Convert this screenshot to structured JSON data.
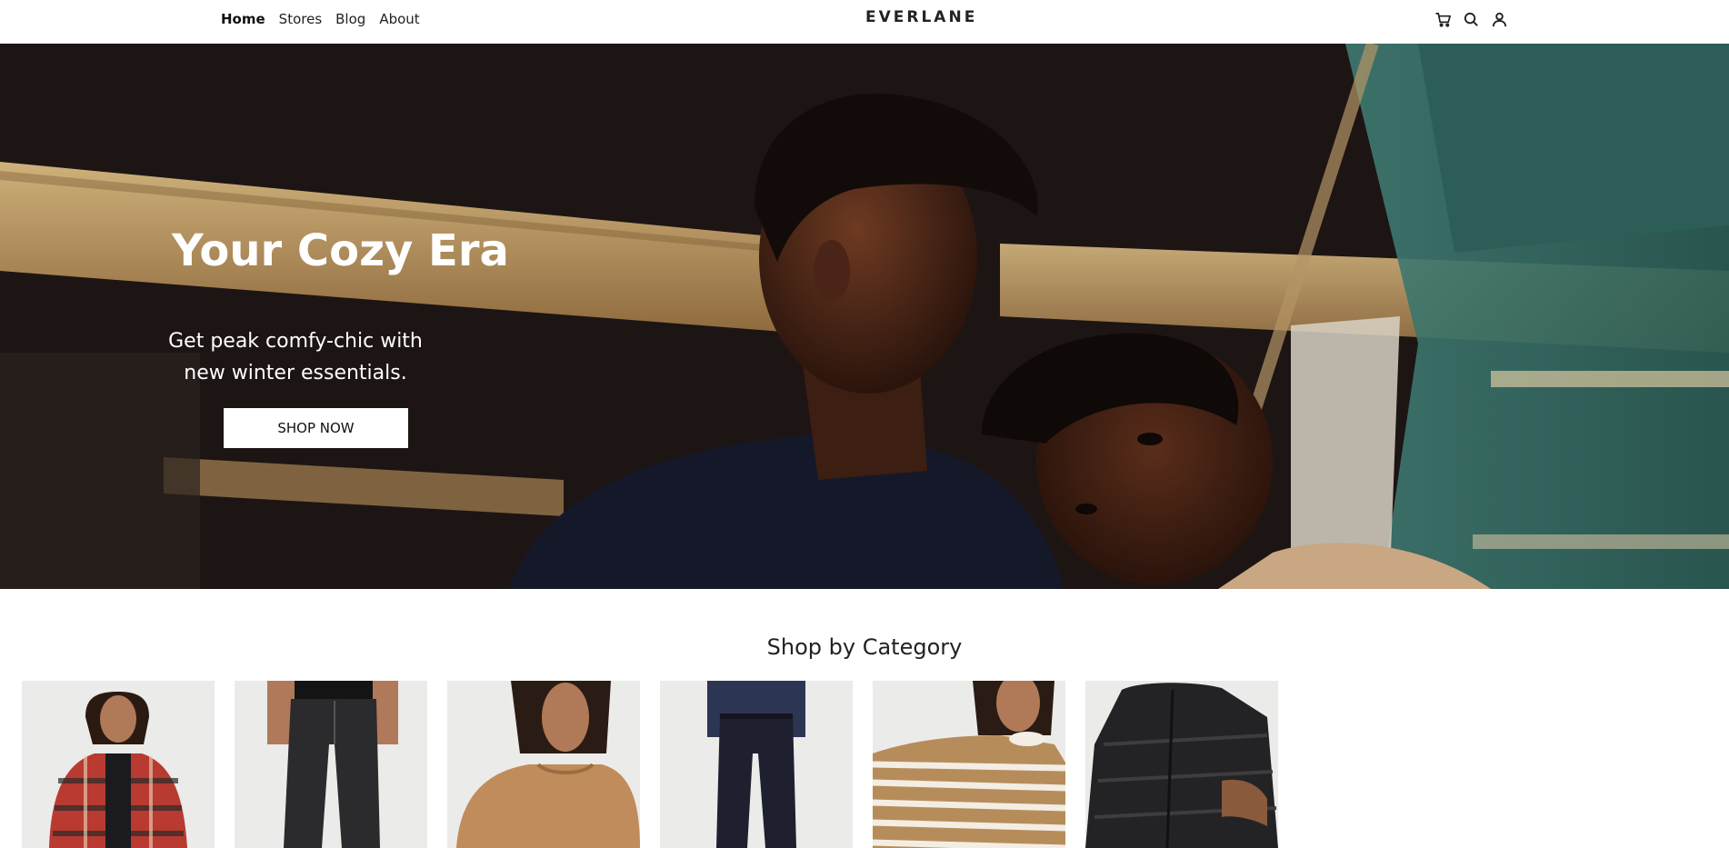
{
  "nav": {
    "items": [
      {
        "label": "Home",
        "active": true
      },
      {
        "label": "Stores",
        "active": false
      },
      {
        "label": "Blog",
        "active": false
      },
      {
        "label": "About",
        "active": false
      }
    ]
  },
  "brand": {
    "logo_text": "EVERLANE"
  },
  "header_icons": [
    "cart-icon",
    "search-icon",
    "account-icon"
  ],
  "hero": {
    "title": "Your Cozy Era",
    "subtitle": "Get peak comfy-chic with new winter essentials.",
    "cta_label": "SHOP NOW"
  },
  "categories": {
    "title": "Shop by Category",
    "items": [
      {
        "image": "red-plaid-flannel-shirt"
      },
      {
        "image": "black-denim-jeans"
      },
      {
        "image": "tan-crewneck-tee"
      },
      {
        "image": "navy-dress-pants"
      },
      {
        "image": "striped-sweater"
      },
      {
        "image": "black-puffer-jacket"
      }
    ]
  },
  "colors": {
    "text_dark": "#1a1a1a",
    "hero_dark": "#1c1413",
    "button_bg": "#ffffff",
    "accent_teal": "#2f6b63",
    "accent_wood": "#c9a26a"
  }
}
